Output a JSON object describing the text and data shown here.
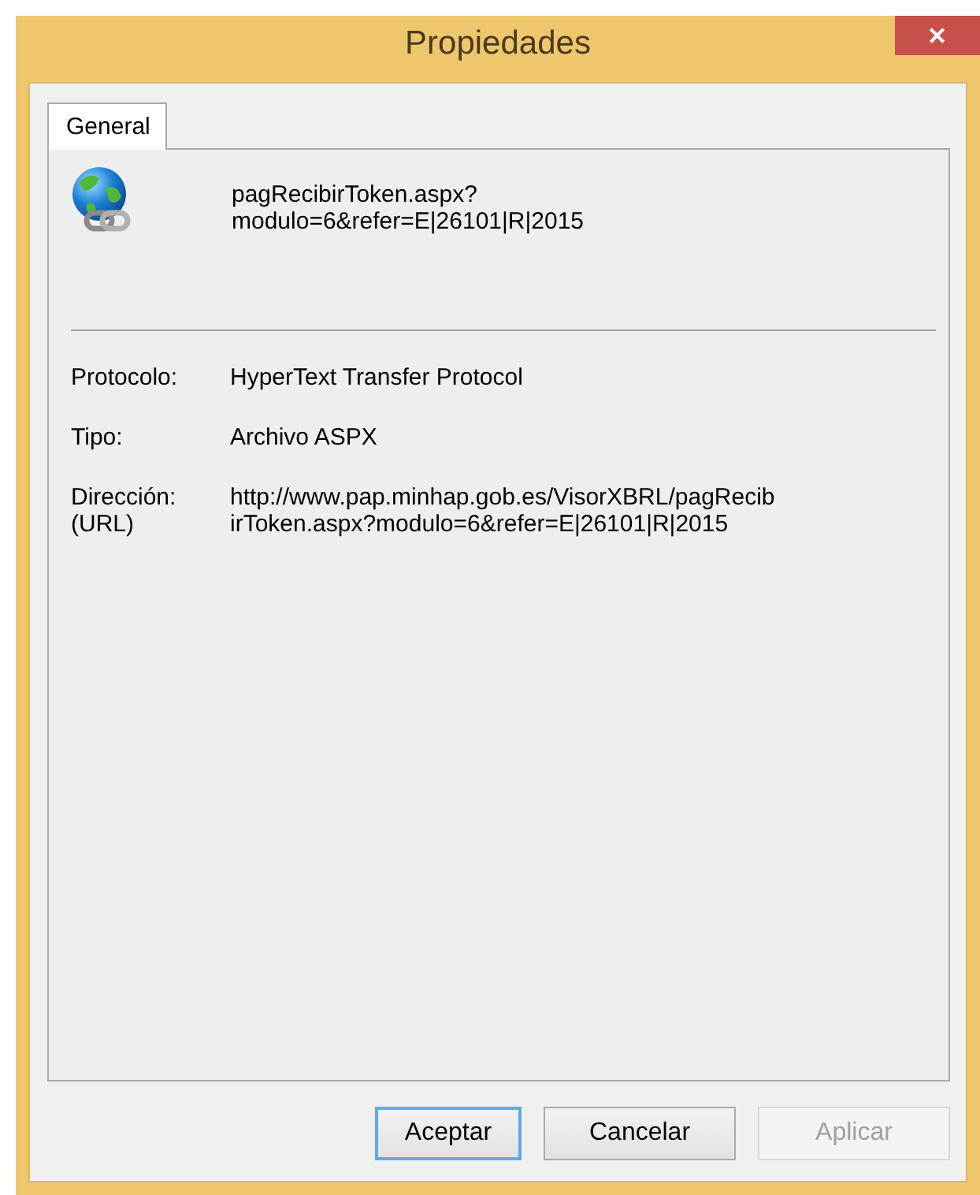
{
  "window": {
    "title": "Propiedades",
    "close": "✕"
  },
  "tabs": [
    {
      "label": "General",
      "selected": true
    }
  ],
  "header": {
    "name_lines": [
      "pagRecibirToken.aspx?",
      "modulo=6&refer=E|26101|R|2015"
    ]
  },
  "properties": [
    {
      "label_lines": [
        "Protocolo:"
      ],
      "value_lines": [
        "HyperText Transfer Protocol"
      ]
    },
    {
      "label_lines": [
        "Tipo:"
      ],
      "value_lines": [
        "Archivo ASPX"
      ]
    },
    {
      "label_lines": [
        "Dirección:",
        "(URL)"
      ],
      "value_lines": [
        "http://www.pap.minhap.gob.es/VisorXBRL/pagRecib",
        "irToken.aspx?modulo=6&refer=E|26101|R|2015"
      ]
    }
  ],
  "buttons": [
    {
      "label": "Aceptar",
      "default": true,
      "disabled": false
    },
    {
      "label": "Cancelar",
      "default": false,
      "disabled": false
    },
    {
      "label": "Aplicar",
      "default": false,
      "disabled": true
    }
  ]
}
